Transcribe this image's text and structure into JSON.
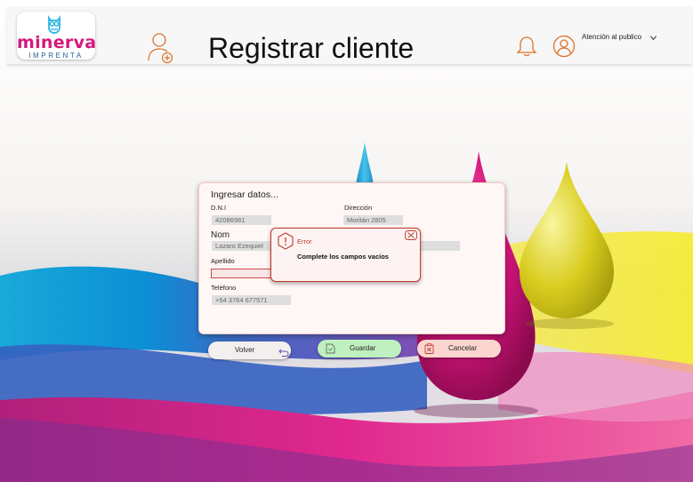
{
  "header": {
    "logo_text": "minerva",
    "logo_subtext": "IMPRENTA",
    "title": "Registrar cliente",
    "user_role": "Atención al publico"
  },
  "form": {
    "heading": "Ingresar datos...",
    "dni_label": "D.N.I",
    "dni_value": "42086981",
    "direccion_label": "Dirección",
    "direccion_value": "Moritán 2805",
    "nombre_label": "Nom",
    "nombre_value": "Lazaro Ezequiel",
    "apellido_label": "Apellido",
    "apellido_value": "",
    "telefono_label": "Teléfono",
    "telefono_value": "+54 3764 677571"
  },
  "error_dialog": {
    "title": "Error",
    "message": "Complete los campos vacíos"
  },
  "buttons": {
    "back": "Volver",
    "save": "Guardar",
    "cancel": "Cancelar"
  },
  "colors": {
    "brand_pink": "#d6197c",
    "brand_blue": "#2a5e9a",
    "accent_orange": "#e0712c",
    "error_red": "#c0392b",
    "save_green": "#bff0bf",
    "cancel_pink": "#fbd6cf"
  }
}
